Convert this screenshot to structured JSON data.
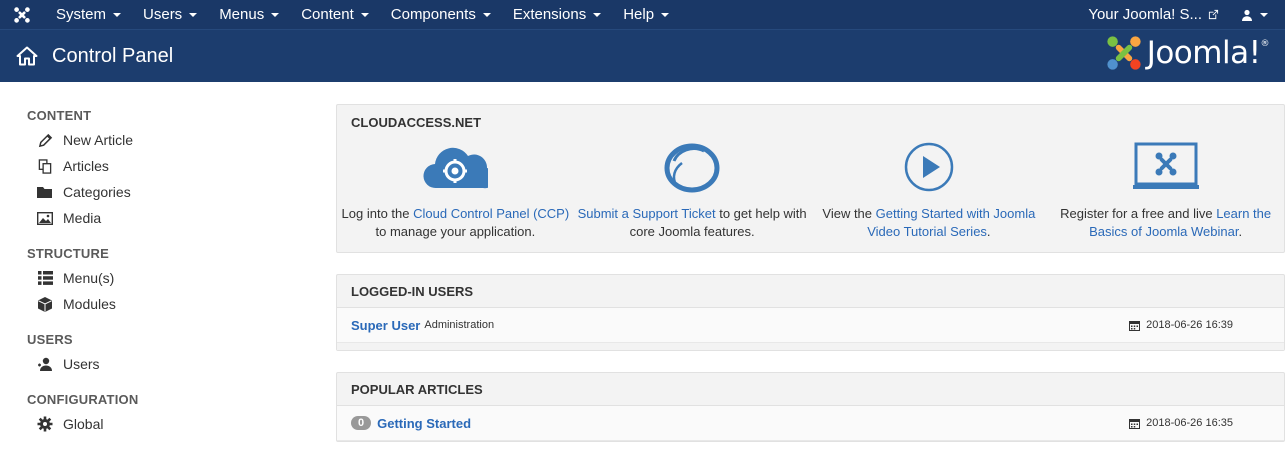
{
  "topnav": {
    "menus": [
      "System",
      "Users",
      "Menus",
      "Content",
      "Components",
      "Extensions",
      "Help"
    ],
    "site_link": "Your Joomla! S..."
  },
  "header": {
    "title": "Control Panel",
    "brand": "Joomla!"
  },
  "sidebar": {
    "content_head": "CONTENT",
    "content_items": [
      "New Article",
      "Articles",
      "Categories",
      "Media"
    ],
    "structure_head": "STRUCTURE",
    "structure_items": [
      "Menu(s)",
      "Modules"
    ],
    "users_head": "USERS",
    "users_items": [
      "Users"
    ],
    "config_head": "CONFIGURATION",
    "config_items": [
      "Global"
    ]
  },
  "cloudaccess": {
    "title": "CLOUDACCESS.NET",
    "col1_pre": "Log into the ",
    "col1_link": "Cloud Control Panel (CCP)",
    "col1_post": " to manage your application.",
    "col2_link": "Submit a Support Ticket",
    "col2_post": " to get help with core Joomla features.",
    "col3_pre": "View the ",
    "col3_link": "Getting Started with Joomla Video Tutorial Series",
    "col3_post": ".",
    "col4_pre": "Register for a free and live ",
    "col4_link": "Learn the Basics of Joomla Webinar",
    "col4_post": "."
  },
  "logged_in": {
    "title": "LOGGED-IN USERS",
    "user": "Super User",
    "role": "Administration",
    "date": "2018-06-26 16:39"
  },
  "popular": {
    "title": "POPULAR ARTICLES",
    "count": "0",
    "article": "Getting Started",
    "date": "2018-06-26 16:35"
  },
  "colors": {
    "nav": "#1a3867",
    "header": "#1c3d6e",
    "link": "#2a69b8",
    "cca_icon": "#3b7ab8"
  }
}
